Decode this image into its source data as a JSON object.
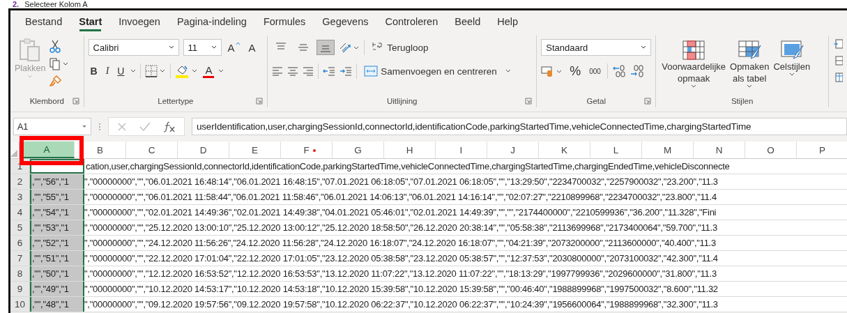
{
  "heading": {
    "number": "2.",
    "text": "Selecteer Kolom A"
  },
  "tabs": [
    {
      "label": "Bestand",
      "selected": false
    },
    {
      "label": "Start",
      "selected": true
    },
    {
      "label": "Invoegen",
      "selected": false
    },
    {
      "label": "Pagina-indeling",
      "selected": false
    },
    {
      "label": "Formules",
      "selected": false
    },
    {
      "label": "Gegevens",
      "selected": false
    },
    {
      "label": "Controleren",
      "selected": false
    },
    {
      "label": "Beeld",
      "selected": false
    },
    {
      "label": "Help",
      "selected": false
    }
  ],
  "clipboard": {
    "paste": "Plakken",
    "paste_disabled": true,
    "label": "Klembord"
  },
  "font": {
    "name": "Calibri",
    "size": "11",
    "grow": "A",
    "shrink": "A",
    "styles": [
      "B",
      "I",
      "U"
    ],
    "color_letter": "A",
    "label": "Lettertype"
  },
  "alignment": {
    "vertical": [
      {
        "selected": false
      },
      {
        "selected": false
      },
      {
        "selected": true
      }
    ],
    "wrap": "Terugloop",
    "merge": "Samenvoegen en centreren",
    "label": "Uitlijning"
  },
  "number": {
    "format": "Standaard",
    "percent": "%",
    "thousands": "000",
    "label": "Getal"
  },
  "styles": {
    "buttons": [
      {
        "lines": [
          "Voorwaardelijke",
          "opmaak"
        ]
      },
      {
        "lines": [
          "Opmaken",
          "als tabel"
        ]
      },
      {
        "lines": [
          "Celstijlen"
        ]
      }
    ],
    "label": "Stijlen"
  },
  "name_box": "A1",
  "formula": "userIdentification,user,chargingSessionId,connectorId,identificationCode,parkingStartedTime,vehicleConnectedTime,chargingStartedTime",
  "columns": [
    {
      "label": "A",
      "selected": true,
      "dot": false
    },
    {
      "label": "B",
      "selected": false,
      "dot": false
    },
    {
      "label": "C",
      "selected": false,
      "dot": false
    },
    {
      "label": "D",
      "selected": false,
      "dot": false
    },
    {
      "label": "E",
      "selected": false,
      "dot": false
    },
    {
      "label": "F",
      "selected": false,
      "dot": true
    },
    {
      "label": "G",
      "selected": false,
      "dot": false
    },
    {
      "label": "H",
      "selected": false,
      "dot": false
    },
    {
      "label": "I",
      "selected": false,
      "dot": false
    },
    {
      "label": "J",
      "selected": false,
      "dot": false
    },
    {
      "label": "K",
      "selected": false,
      "dot": false
    },
    {
      "label": "L",
      "selected": false,
      "dot": false
    },
    {
      "label": "M",
      "selected": false,
      "dot": false
    },
    {
      "label": "N",
      "selected": false,
      "dot": false
    },
    {
      "label": "O",
      "selected": false,
      "dot": false
    },
    {
      "label": "P",
      "selected": false,
      "dot": false
    }
  ],
  "header_row": {
    "number": "1",
    "text": "cation,user,chargingSessionId,connectorId,identificationCode,parkingStartedTime,vehicleConnectedTime,chargingStartedTime,chargingEndedTime,vehicleDisconnecte"
  },
  "rows": [
    {
      "number": "2",
      "cell_a": ",\"\",\"56\",\"1",
      "rest": "\",\"00000000\",\"\",\"06.01.2021 16:48:14\",\"06.01.2021 16:48:15\",\"07.01.2021 06:18:05\",\"07.01.2021 06:18:05\",\"\",\"13:29:50\",\"2234700032\",\"2257900032\",\"23.200\",\"11.3"
    },
    {
      "number": "3",
      "cell_a": ",\"\",\"55\",\"1",
      "rest": "\",\"00000000\",\"\",\"06.01.2021 11:58:44\",\"06.01.2021 11:58:46\",\"06.01.2021 14:06:13\",\"06.01.2021 14:16:14\",\"\",\"02:07:27\",\"2210899968\",\"2234700032\",\"23.800\",\"11.4"
    },
    {
      "number": "4",
      "cell_a": ",\"\",\"54\",\"1",
      "rest": "\",\"00000000\",\"\",\"02.01.2021 14:49:36\",\"02.01.2021 14:49:38\",\"04.01.2021 05:46:01\",\"02.01.2021 14:49:39\",\"\",\"\",\"2174400000\",\"2210599936\",\"36.200\",\"11.328\",\"Fini"
    },
    {
      "number": "5",
      "cell_a": ",\"\",\"53\",\"1",
      "rest": "\",\"00000000\",\"\",\"25.12.2020 13:00:10\",\"25.12.2020 13:00:12\",\"25.12.2020 18:58:50\",\"26.12.2020 20:38:14\",\"\",\"05:58:38\",\"2113699968\",\"2173400064\",\"59.700\",\"11.3"
    },
    {
      "number": "6",
      "cell_a": ",\"\",\"52\",\"1",
      "rest": "\",\"00000000\",\"\",\"24.12.2020 11:56:26\",\"24.12.2020 11:56:28\",\"24.12.2020 16:18:07\",\"24.12.2020 16:18:07\",\"\",\"04:21:39\",\"2073200000\",\"2113600000\",\"40.400\",\"11.3"
    },
    {
      "number": "7",
      "cell_a": ",\"\",\"51\",\"1",
      "rest": "\",\"00000000\",\"\",\"22.12.2020 17:01:04\",\"22.12.2020 17:01:05\",\"23.12.2020 05:38:58\",\"23.12.2020 05:38:57\",\"\",\"12:37:53\",\"2030800000\",\"2073100032\",\"42.300\",\"11.4"
    },
    {
      "number": "8",
      "cell_a": ",\"\",\"50\",\"1",
      "rest": "\",\"00000000\",\"\",\"12.12.2020 16:53:52\",\"12.12.2020 16:53:53\",\"13.12.2020 11:07:22\",\"13.12.2020 11:07:22\",\"\",\"18:13:29\",\"1997799936\",\"2029600000\",\"31.800\",\"11.3"
    },
    {
      "number": "9",
      "cell_a": ",\"\",\"49\",\"1",
      "rest": "\",\"00000000\",\"\",\"10.12.2020 14:53:17\",\"10.12.2020 14:53:18\",\"10.12.2020 15:39:58\",\"10.12.2020 15:39:58\",\"\",\"00:46:40\",\"1988899968\",\"1997500032\",\"8.600\",\"11.32"
    },
    {
      "number": "10",
      "cell_a": ",\"\",\"48\",\"1",
      "rest": "\",\"00000000\",\"\",\"09.12.2020 19:57:56\",\"09.12.2020 19:57:58\",\"10.12.2020 06:22:37\",\"10.12.2020 06:22:37\",\"\",\"10:24:39\",\"1956600064\",\"1988899968\",\"32.300\",\"11.3"
    }
  ]
}
